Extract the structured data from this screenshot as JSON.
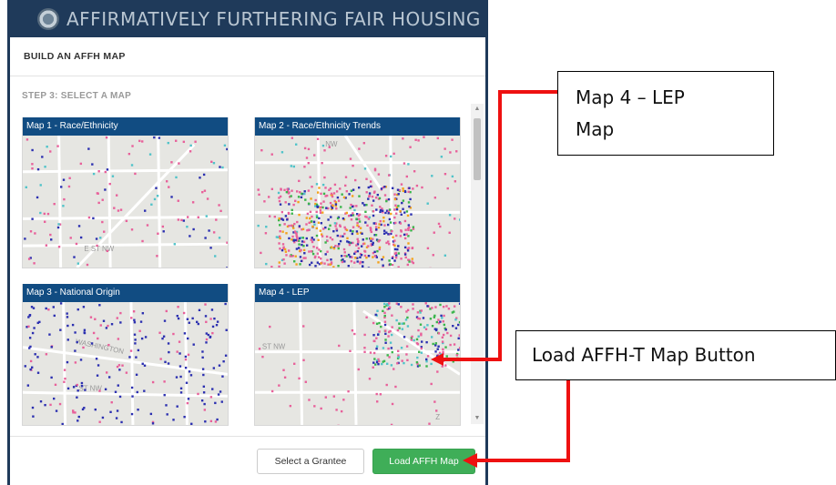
{
  "app": {
    "title": "AFFIRMATIVELY FURTHERING FAIR HOUSING",
    "seal_icon": "hud-seal-icon"
  },
  "dialog": {
    "title": "BUILD AN AFFH MAP",
    "step_label": "STEP 3: SELECT A MAP",
    "maps": [
      {
        "title": "Map 1 - Race/Ethnicity"
      },
      {
        "title": "Map 2 - Race/Ethnicity Trends"
      },
      {
        "title": "Map 3 - National Origin"
      },
      {
        "title": "Map 4 - LEP"
      }
    ],
    "map_text": {
      "map1_street": "E ST NW",
      "map2_street": "NW",
      "map3_street1": "WASHINGTON",
      "map3_street2": "ST NW",
      "map4_street": "ST NW",
      "map4_corner": "Z"
    },
    "buttons": {
      "select_grantee": "Select a Grantee",
      "load_map": "Load AFFH Map"
    }
  },
  "callouts": {
    "map4_line1": "Map 4 – LEP",
    "map4_line2": "Map",
    "load_button": "Load AFFH-T Map Button"
  },
  "colors": {
    "header_bg": "#1f3a5a",
    "card_title_bg": "#114c82",
    "success": "#3fae58",
    "annotation_arrow": "#ee1111"
  }
}
